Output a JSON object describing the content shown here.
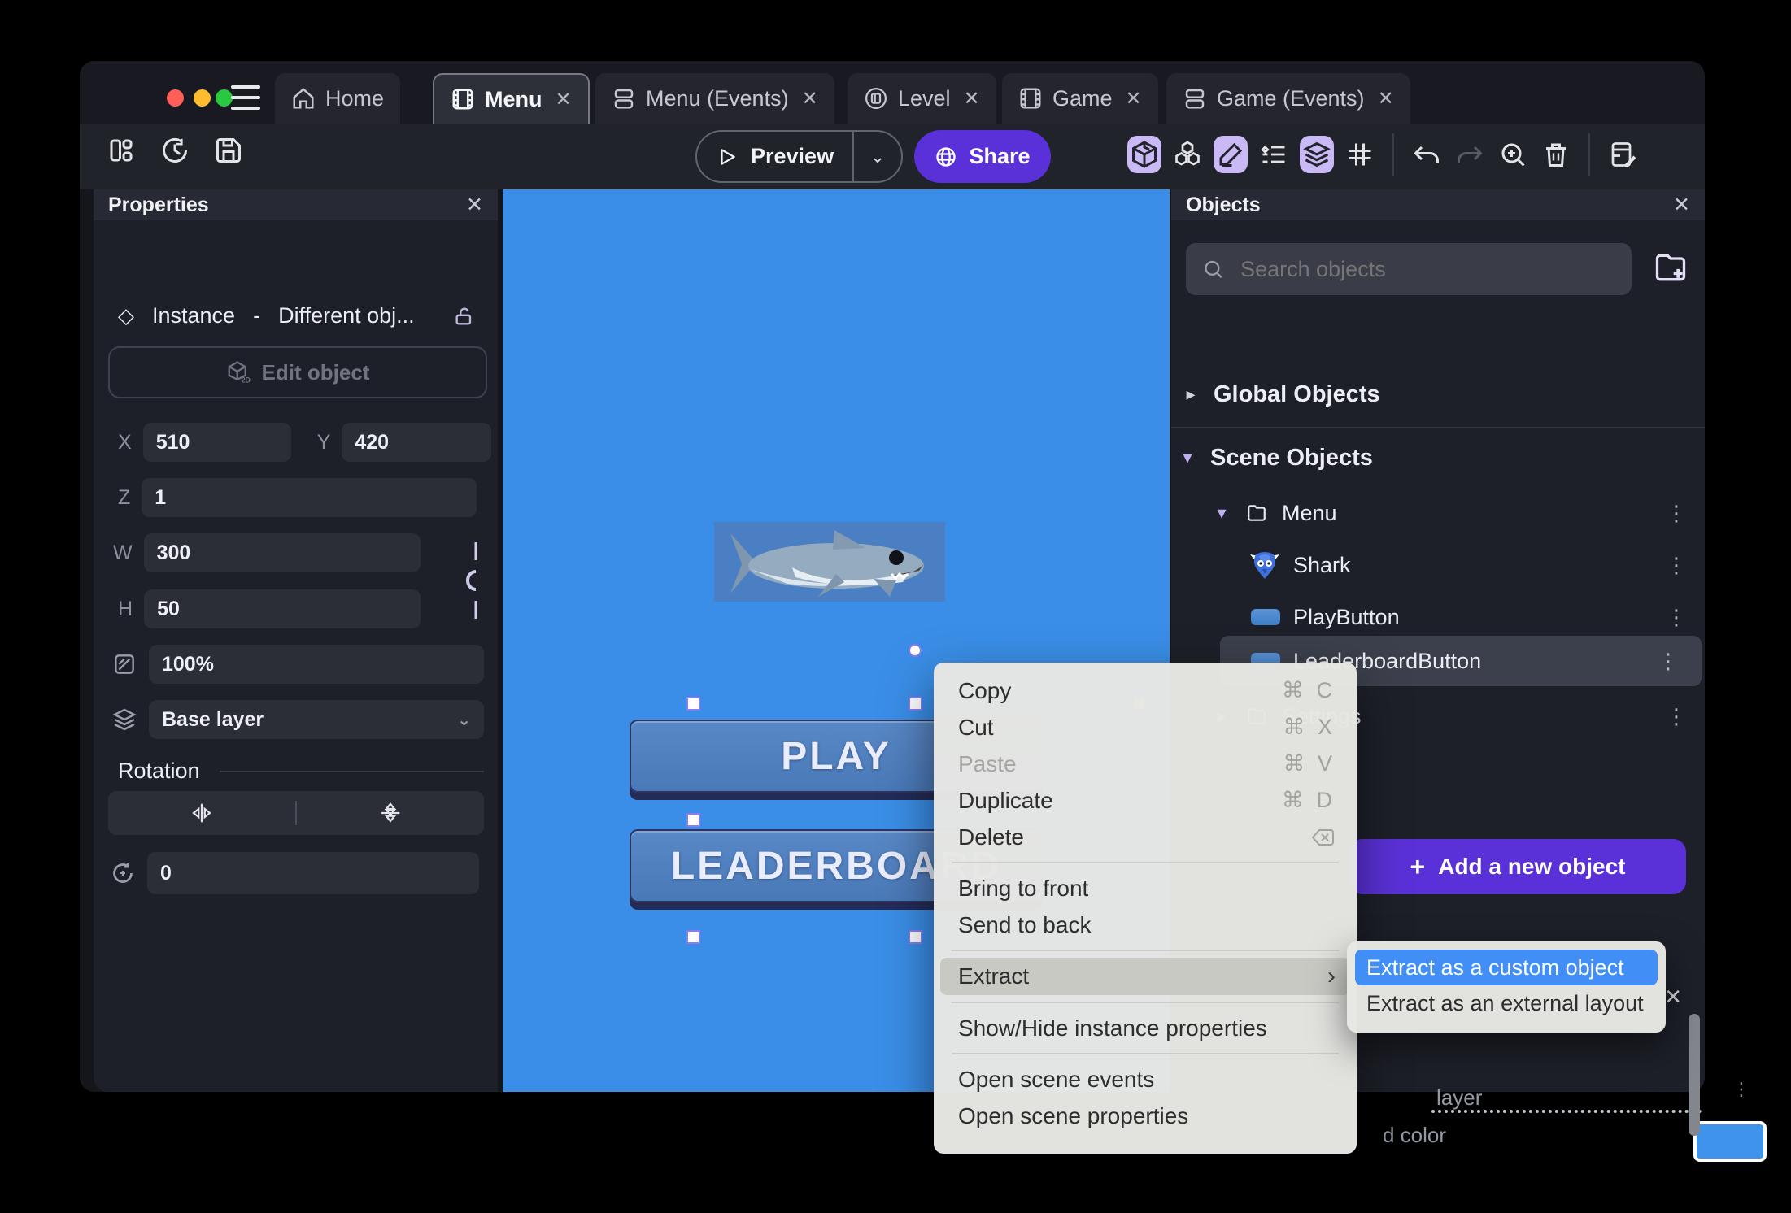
{
  "titlebar": {
    "tabs": [
      {
        "label": "Home"
      },
      {
        "label": "Menu"
      },
      {
        "label": "Menu (Events)"
      },
      {
        "label": "Level"
      },
      {
        "label": "Game"
      },
      {
        "label": "Game (Events)"
      }
    ],
    "close_glyph": "✕"
  },
  "toolbar": {
    "preview_label": "Preview",
    "share_label": "Share"
  },
  "properties": {
    "title": "Properties",
    "instance_type": "Instance",
    "separator": "-",
    "instance_value": "Different obj...",
    "edit_object_label": "Edit object",
    "x_label": "X",
    "x_value": "510",
    "y_label": "Y",
    "y_value": "420",
    "z_label": "Z",
    "z_value": "1",
    "w_label": "W",
    "w_value": "300",
    "h_label": "H",
    "h_value": "50",
    "opacity_value": "100%",
    "layer_value": "Base layer",
    "rotation_title": "Rotation",
    "angle_value": "0"
  },
  "scene": {
    "play_label": "PLAY",
    "leaderboard_label": "LEADERBOARD"
  },
  "objects": {
    "title": "Objects",
    "search_placeholder": "Search objects",
    "global_label": "Global Objects",
    "scene_label": "Scene Objects",
    "tree": [
      {
        "label": "Menu"
      },
      {
        "label": "Shark"
      },
      {
        "label": "PlayButton"
      },
      {
        "label": "LeaderboardButton"
      },
      {
        "label": "Settings"
      }
    ],
    "add_plus": "+",
    "add_button_label": "Add a new object"
  },
  "context_menu": {
    "items": [
      {
        "label": "Copy",
        "shortcut": "⌘ C"
      },
      {
        "label": "Cut",
        "shortcut": "⌘ X"
      },
      {
        "label": "Paste",
        "shortcut": "⌘ V"
      },
      {
        "label": "Duplicate",
        "shortcut": "⌘ D"
      },
      {
        "label": "Delete"
      },
      {
        "label": "Bring to front"
      },
      {
        "label": "Send to back"
      },
      {
        "label": "Extract",
        "arrow": "›"
      },
      {
        "label": "Show/Hide instance properties"
      },
      {
        "label": "Open scene events"
      },
      {
        "label": "Open scene properties"
      }
    ]
  },
  "submenu": {
    "items": [
      {
        "label": "Extract as a custom object"
      },
      {
        "label": "Extract as an external layout"
      }
    ]
  },
  "bottom_panel": {
    "layer_text": "layer",
    "color_text": "d color"
  }
}
